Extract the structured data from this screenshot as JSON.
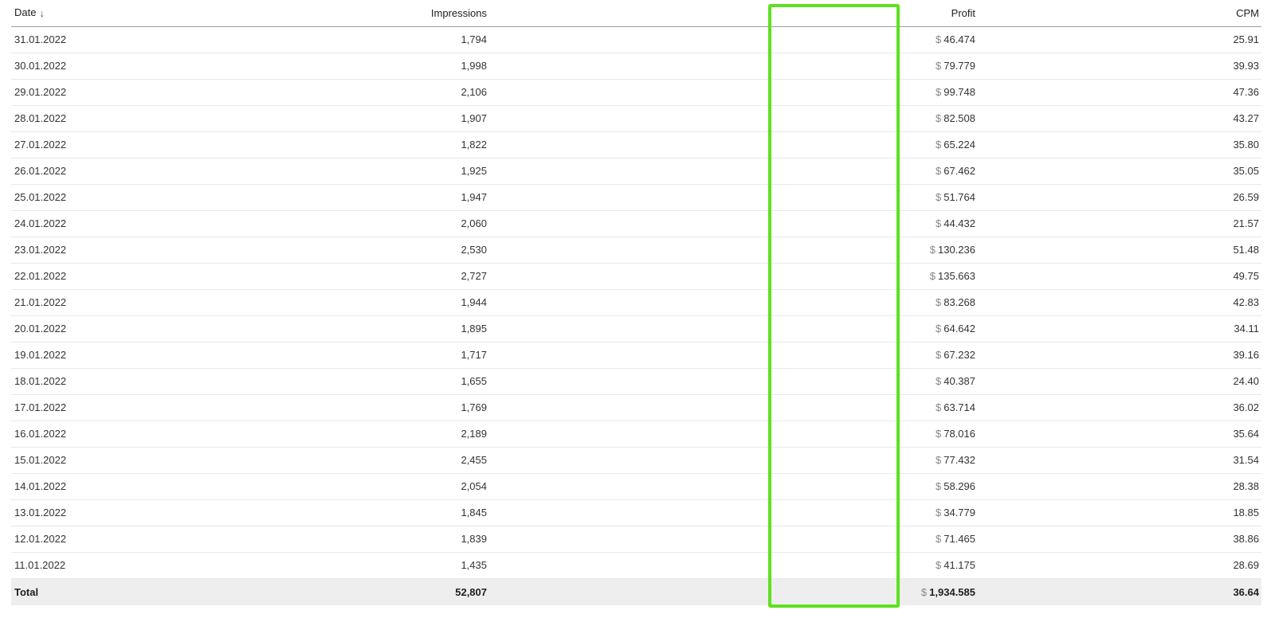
{
  "table": {
    "headers": {
      "date": "Date",
      "impressions": "Impressions",
      "profit": "Profit",
      "cpm": "CPM"
    },
    "sort_icon": "arrow-down-icon",
    "sort_glyph": "↓",
    "currency_symbol": "$",
    "rows": [
      {
        "date": "31.01.2022",
        "impressions": "1,794",
        "profit": "46.474",
        "cpm": "25.91"
      },
      {
        "date": "30.01.2022",
        "impressions": "1,998",
        "profit": "79.779",
        "cpm": "39.93"
      },
      {
        "date": "29.01.2022",
        "impressions": "2,106",
        "profit": "99.748",
        "cpm": "47.36"
      },
      {
        "date": "28.01.2022",
        "impressions": "1,907",
        "profit": "82.508",
        "cpm": "43.27"
      },
      {
        "date": "27.01.2022",
        "impressions": "1,822",
        "profit": "65.224",
        "cpm": "35.80"
      },
      {
        "date": "26.01.2022",
        "impressions": "1,925",
        "profit": "67.462",
        "cpm": "35.05"
      },
      {
        "date": "25.01.2022",
        "impressions": "1,947",
        "profit": "51.764",
        "cpm": "26.59"
      },
      {
        "date": "24.01.2022",
        "impressions": "2,060",
        "profit": "44.432",
        "cpm": "21.57"
      },
      {
        "date": "23.01.2022",
        "impressions": "2,530",
        "profit": "130.236",
        "cpm": "51.48"
      },
      {
        "date": "22.01.2022",
        "impressions": "2,727",
        "profit": "135.663",
        "cpm": "49.75"
      },
      {
        "date": "21.01.2022",
        "impressions": "1,944",
        "profit": "83.268",
        "cpm": "42.83"
      },
      {
        "date": "20.01.2022",
        "impressions": "1,895",
        "profit": "64.642",
        "cpm": "34.11"
      },
      {
        "date": "19.01.2022",
        "impressions": "1,717",
        "profit": "67.232",
        "cpm": "39.16"
      },
      {
        "date": "18.01.2022",
        "impressions": "1,655",
        "profit": "40.387",
        "cpm": "24.40"
      },
      {
        "date": "17.01.2022",
        "impressions": "1,769",
        "profit": "63.714",
        "cpm": "36.02"
      },
      {
        "date": "16.01.2022",
        "impressions": "2,189",
        "profit": "78.016",
        "cpm": "35.64"
      },
      {
        "date": "15.01.2022",
        "impressions": "2,455",
        "profit": "77.432",
        "cpm": "31.54"
      },
      {
        "date": "14.01.2022",
        "impressions": "2,054",
        "profit": "58.296",
        "cpm": "28.38"
      },
      {
        "date": "13.01.2022",
        "impressions": "1,845",
        "profit": "34.779",
        "cpm": "18.85"
      },
      {
        "date": "12.01.2022",
        "impressions": "1,839",
        "profit": "71.465",
        "cpm": "38.86"
      },
      {
        "date": "11.01.2022",
        "impressions": "1,435",
        "profit": "41.175",
        "cpm": "28.69"
      }
    ],
    "total": {
      "label": "Total",
      "impressions": "52,807",
      "profit": "1,934.585",
      "cpm": "36.64"
    }
  },
  "colors": {
    "highlight_border": "#5ee01f",
    "total_row_bg": "#eeeeee",
    "currency_symbol": "#888888"
  }
}
